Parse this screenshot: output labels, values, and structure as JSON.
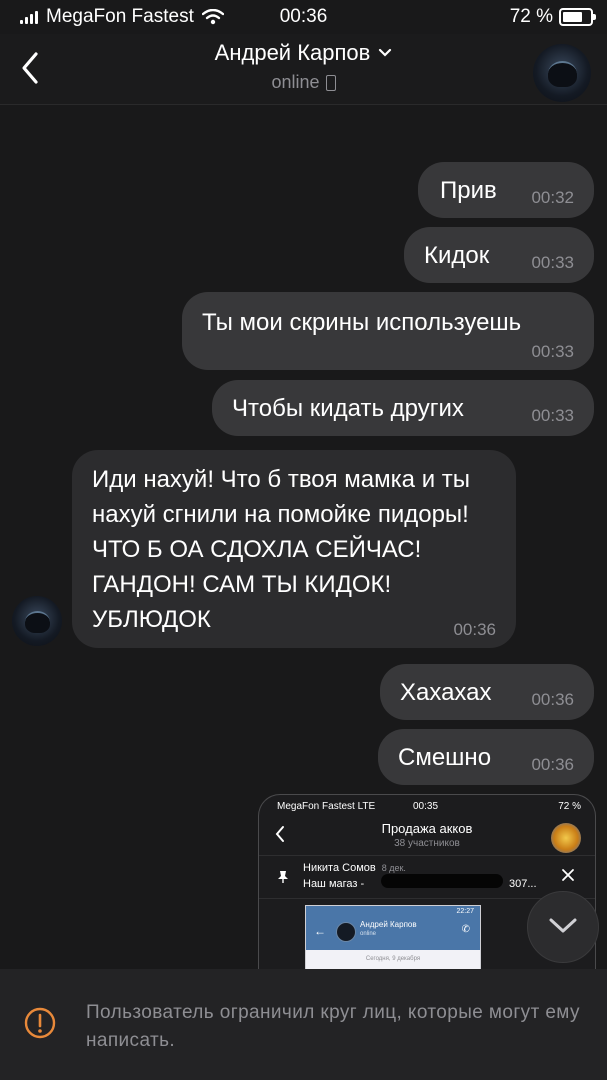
{
  "status_bar": {
    "carrier": "MegaFon Fastest",
    "time": "00:36",
    "battery": "72 %"
  },
  "header": {
    "contact_name": "Андрей Карпов",
    "status": "online"
  },
  "messages": [
    {
      "direction": "out",
      "text": "Прив",
      "time": "00:32"
    },
    {
      "direction": "out",
      "text": "Кидок",
      "time": "00:33"
    },
    {
      "direction": "out",
      "text": "Ты мои скрины используешь",
      "time": "00:33"
    },
    {
      "direction": "out",
      "text": "Чтобы кидать других",
      "time": "00:33"
    },
    {
      "direction": "in",
      "text": "Иди нахуй! Что б твоя мамка и ты нахуй сгнили на помойке пидоры! ЧТО Б ОА СДОХЛА СЕЙЧАС! ГАНДОН! САМ ТЫ КИДОК! УБЛЮДОК",
      "time": "00:36"
    },
    {
      "direction": "out",
      "text": "Хахахах",
      "time": "00:36"
    },
    {
      "direction": "out",
      "text": "Смешно",
      "time": "00:36"
    }
  ],
  "attachment": {
    "status_left": "MegaFon Fastest LTE",
    "status_time": "00:35",
    "status_battery": "72 %",
    "group_title": "Продажа акков",
    "group_members": "38 участников",
    "pinned_name": "Никита Сомов",
    "pinned_date": "8 дек.",
    "pinned_text": "Наш магаз -",
    "pinned_suffix": "307...",
    "inner_status": "22:27",
    "inner_name": "Андрей Карпов",
    "inner_online": "online",
    "inner_date": "Сегодня, 9 декабря"
  },
  "footer": {
    "notice": "Пользователь ограничил круг лиц, которые могут ему написать."
  },
  "colors": {
    "background": "#19191a",
    "bubble_out": "#38383a",
    "bubble_in": "#2c2c2e",
    "warning": "#e8893a"
  }
}
